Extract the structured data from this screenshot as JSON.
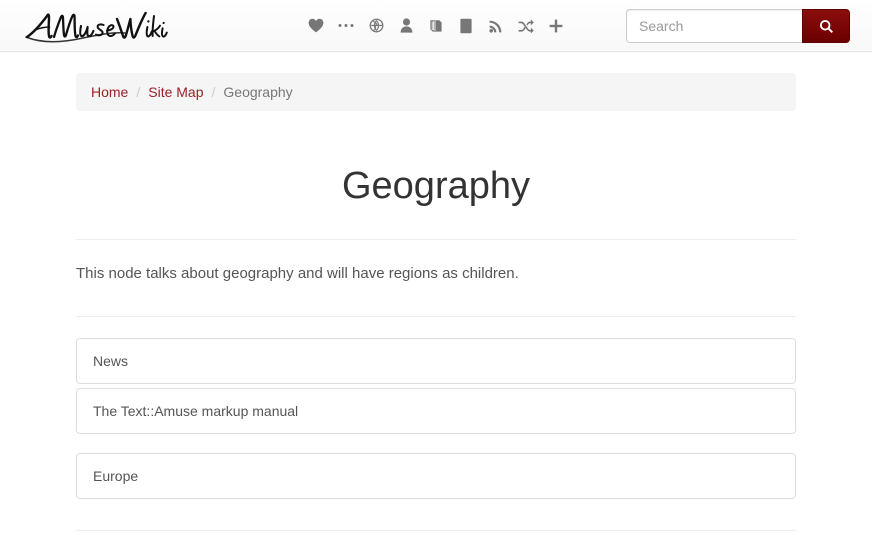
{
  "navbar": {
    "brand_label": "AMuseWiki",
    "icons": [
      {
        "name": "heart-icon",
        "title": "Favorites"
      },
      {
        "name": "ellipsis-icon",
        "title": "More"
      },
      {
        "name": "globe-icon",
        "title": "Language"
      },
      {
        "name": "user-icon",
        "title": "User"
      },
      {
        "name": "book-icon",
        "title": "Library"
      },
      {
        "name": "tablet-icon",
        "title": "Device"
      },
      {
        "name": "rss-icon",
        "title": "Feed"
      },
      {
        "name": "shuffle-icon",
        "title": "Random"
      },
      {
        "name": "plus-icon",
        "title": "Add"
      }
    ]
  },
  "search": {
    "placeholder": "Search",
    "value": "",
    "button_icon": "search-icon"
  },
  "breadcrumb": {
    "items": [
      {
        "label": "Home",
        "active": false
      },
      {
        "label": "Site Map",
        "active": false
      },
      {
        "label": "Geography",
        "active": true
      }
    ],
    "separator": "/"
  },
  "main": {
    "title": "Geography",
    "description": "This node talks about geography and will have regions as children.",
    "groups": [
      {
        "items": [
          {
            "label": "News"
          },
          {
            "label": "The Text::Amuse markup manual"
          }
        ]
      },
      {
        "items": [
          {
            "label": "Europe"
          }
        ]
      }
    ]
  },
  "colors": {
    "accent_red": "#9c2028",
    "search_button": "#6b0000",
    "icon_gray": "#777777",
    "breadcrumb_bg": "#f5f5f5",
    "border": "#dddddd"
  }
}
